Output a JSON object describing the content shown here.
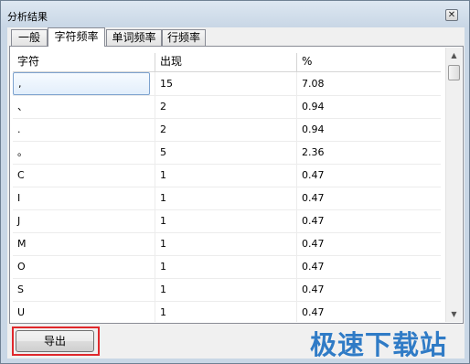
{
  "window": {
    "title": "分析结果",
    "close_glyph": "✕"
  },
  "tabs": [
    {
      "label": "一般",
      "active": false
    },
    {
      "label": "字符频率",
      "active": true
    },
    {
      "label": "单词频率",
      "active": false
    },
    {
      "label": "行频率",
      "active": false
    }
  ],
  "table": {
    "columns": [
      "字符",
      "出现",
      "%"
    ],
    "rows": [
      {
        "char": ",",
        "count": "15",
        "percent": "7.08"
      },
      {
        "char": "、",
        "count": "2",
        "percent": "0.94"
      },
      {
        "char": ".",
        "count": "2",
        "percent": "0.94"
      },
      {
        "char": "。",
        "count": "5",
        "percent": "2.36"
      },
      {
        "char": "C",
        "count": "1",
        "percent": "0.47"
      },
      {
        "char": "I",
        "count": "1",
        "percent": "0.47"
      },
      {
        "char": "J",
        "count": "1",
        "percent": "0.47"
      },
      {
        "char": "M",
        "count": "1",
        "percent": "0.47"
      },
      {
        "char": "O",
        "count": "1",
        "percent": "0.47"
      },
      {
        "char": "S",
        "count": "1",
        "percent": "0.47"
      },
      {
        "char": "U",
        "count": "1",
        "percent": "0.47"
      }
    ]
  },
  "scrollbar": {
    "up_glyph": "▲",
    "down_glyph": "▼"
  },
  "buttons": {
    "export_label": "导出"
  },
  "watermark": {
    "text": "极速下载站"
  },
  "colors": {
    "highlight": "#e0282c",
    "watermark": "#1b6fc2",
    "selection": "#e2eefb"
  }
}
